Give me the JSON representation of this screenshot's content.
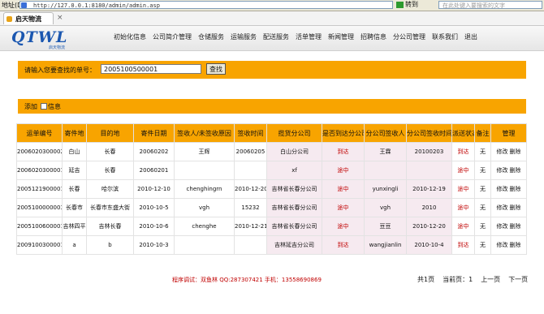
{
  "browser": {
    "address_label": "地址(D)",
    "url": "http://127.0.0.1:8180/admin/admin.asp",
    "go_label": "转到",
    "search_placeholder": "在此处键入要搜索的文字",
    "tab_title": "启天物流"
  },
  "header": {
    "logo_text": "QTWL",
    "logo_sub": "启天物流",
    "nav": [
      "初始化信息",
      "公司简介管理",
      "仓储服务",
      "运输服务",
      "配送服务",
      "活单管理",
      "新闻管理",
      "招聘信息",
      "分公司管理",
      "联系我们",
      "退出"
    ]
  },
  "search": {
    "label": "请输入您要查找的单号：",
    "value": "2005100500001",
    "button": "查找"
  },
  "add": {
    "label1": "添加",
    "label2": "信息"
  },
  "table": {
    "headers": [
      "运单编号",
      "寄件地",
      "目的地",
      "寄件日期",
      "签收人/未签收原因",
      "签收时间",
      "揽货分公司",
      "是否到达分公司",
      "分公司签收人",
      "分公司签收时间",
      "派送状态",
      "备注",
      "管理"
    ],
    "rows": [
      [
        "2006020300002",
        "白山",
        "长春",
        "20060202",
        "王辉",
        "20060205",
        "白山分公司",
        "到达",
        "王霖",
        "20100203",
        "到达",
        "无",
        "修改 删除"
      ],
      [
        "2006020300001",
        "延吉",
        "长春",
        "20060201",
        "",
        "",
        "xf",
        "途中",
        "",
        "",
        "途中",
        "无",
        "修改 删除"
      ],
      [
        "2005121900001",
        "长春",
        "哈尔滨",
        "2010-12-10",
        "chenghingrn",
        "2010-12-20",
        "吉林省长春分公司",
        "途中",
        "yunxingli",
        "2010-12-19",
        "途中",
        "无",
        "修改 删除"
      ],
      [
        "2005100000003",
        "长春市",
        "长春市东盛大街",
        "2010-10-5",
        "vgh",
        "15232",
        "吉林省长春分公司",
        "途中",
        "vgh",
        "2010",
        "途中",
        "无",
        "修改 删除"
      ],
      [
        "2005100600001",
        "吉林四平",
        "吉林长春",
        "2010-10-6",
        "chenghe",
        "2010-12-21",
        "吉林省长春分公司",
        "途中",
        "豆豆",
        "2010-12-20",
        "途中",
        "无",
        "修改 删除"
      ],
      [
        "2009100300001",
        "a",
        "b",
        "2010-10-3",
        "",
        "",
        "吉林延吉分公司",
        "到达",
        "wangjianlin",
        "2010-10-4",
        "到达",
        "无",
        "修改 删除"
      ]
    ]
  },
  "pager": {
    "total": "共1页",
    "current": "当前页：1",
    "prev": "上一页",
    "next": "下一页"
  },
  "footer": {
    "credit": "程序调试：双鱼林  QQ:287307421  手机：13558690869"
  },
  "colors": {
    "accent": "#f8a400",
    "status_red": "#c00000",
    "logo_blue": "#1b57b0"
  }
}
